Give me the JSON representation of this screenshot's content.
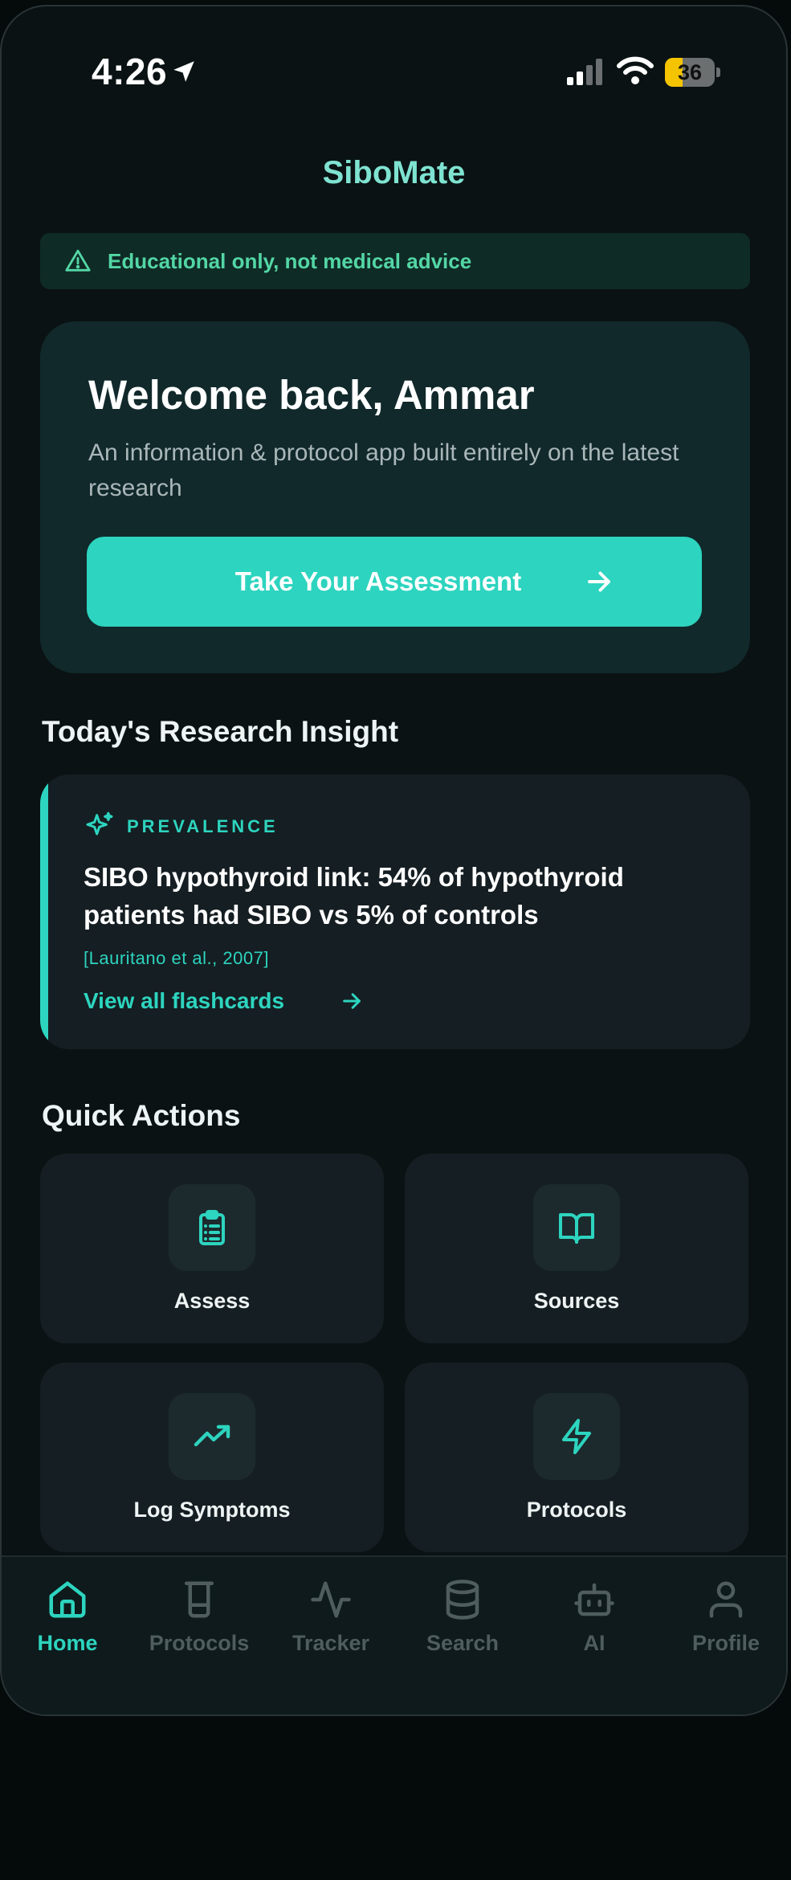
{
  "status_bar": {
    "time": "4:26",
    "battery": "36",
    "battery_level": 0.36
  },
  "app": {
    "title": "SiboMate"
  },
  "banner": {
    "text": "Educational only, not medical advice",
    "icon": "warning-triangle-icon"
  },
  "welcome": {
    "title": "Welcome back, Ammar",
    "subtitle": "An information & protocol app built entirely on the latest research",
    "cta_label": "Take Your Assessment"
  },
  "insight_section": {
    "title": "Today's Research Insight"
  },
  "insight": {
    "tag": "PREVALENCE",
    "fact": "SIBO hypothyroid link: 54% of hypothyroid patients had SIBO vs 5% of controls",
    "citation": "[Lauritano et al., 2007]",
    "link_label": "View all flashcards"
  },
  "quick_actions": {
    "title": "Quick Actions",
    "items": [
      {
        "label": "Assess",
        "icon": "clipboard-list-icon"
      },
      {
        "label": "Sources",
        "icon": "open-book-icon"
      },
      {
        "label": "Log Symptoms",
        "icon": "trending-up-icon"
      },
      {
        "label": "Protocols",
        "icon": "lightning-icon"
      }
    ]
  },
  "tabs": [
    {
      "label": "Home",
      "icon": "home-icon",
      "active": true
    },
    {
      "label": "Protocols",
      "icon": "beaker-icon",
      "active": false
    },
    {
      "label": "Tracker",
      "icon": "activity-pulse-icon",
      "active": false
    },
    {
      "label": "Search",
      "icon": "database-icon",
      "active": false
    },
    {
      "label": "AI",
      "icon": "robot-icon",
      "active": false
    },
    {
      "label": "Profile",
      "icon": "user-icon",
      "active": false
    }
  ],
  "colors": {
    "accent": "#2dd4bf",
    "title_teal": "#7fe3d1",
    "banner_green": "#53d6a5",
    "background": "#0a1213",
    "card": "#151e22",
    "tab_inactive": "#4f5d5f"
  }
}
